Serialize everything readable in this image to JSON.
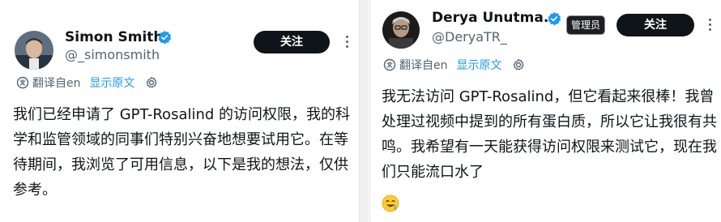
{
  "left_post": {
    "author_name": "Simon Smith",
    "handle": "@_simonsmith",
    "follow_label": "关注",
    "translate": {
      "translated_from": "翻译自en",
      "show_original": "显示原文"
    },
    "text": "我们已经申请了 GPT-Rosalind 的访问权限，我的科学和监管领域的同事们特别兴奋地想要试用它。在等待期间，我浏览了可用信息，以下是我的想法，仅供参考。"
  },
  "right_post": {
    "author_name": "Derya Unutma...",
    "handle": "@DeryaTR_",
    "badge_label": "管理员",
    "follow_label": "关注",
    "translate": {
      "translated_from": "翻译自en",
      "show_original": "显示原文"
    },
    "text": "我无法访问 GPT-Rosalind，但它看起来很棒！我曾处理过视频中提到的所有蛋白质，所以它让我很有共鸣。我希望有一天能获得访问权限来测试它，现在我们只能流口水了",
    "emoji_icon": "drooling-face-icon"
  },
  "colors": {
    "text": "#0f1419",
    "secondary": "#536471",
    "link": "#1d9bf0",
    "verified": "#1d9bf0",
    "follow_button": "#0f1419"
  }
}
